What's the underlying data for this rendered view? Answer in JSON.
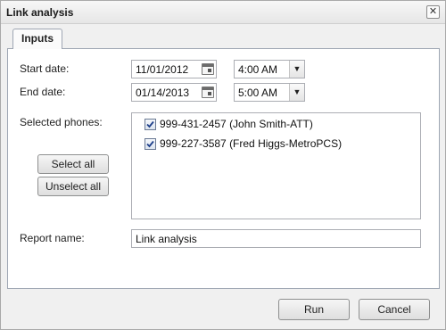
{
  "window": {
    "title": "Link analysis"
  },
  "tabs": [
    {
      "label": "Inputs",
      "active": true
    }
  ],
  "form": {
    "start_date_label": "Start date:",
    "start_date": "11/01/2012",
    "start_time": "4:00 AM",
    "end_date_label": "End date:",
    "end_date": "01/14/2013",
    "end_time": "5:00 AM",
    "selected_phones_label": "Selected phones:",
    "select_all_label": "Select all",
    "unselect_all_label": "Unselect all",
    "phones": [
      {
        "label": "999-431-2457 (John Smith-ATT)",
        "checked": true
      },
      {
        "label": "999-227-3587 (Fred Higgs-MetroPCS)",
        "checked": true
      }
    ],
    "report_name_label": "Report name:",
    "report_name": "Link analysis"
  },
  "footer": {
    "run_label": "Run",
    "cancel_label": "Cancel"
  },
  "icons": {
    "close": "close-icon",
    "calendar": "calendar-icon",
    "dropdown": "chevron-down-icon",
    "check": "check-icon"
  }
}
